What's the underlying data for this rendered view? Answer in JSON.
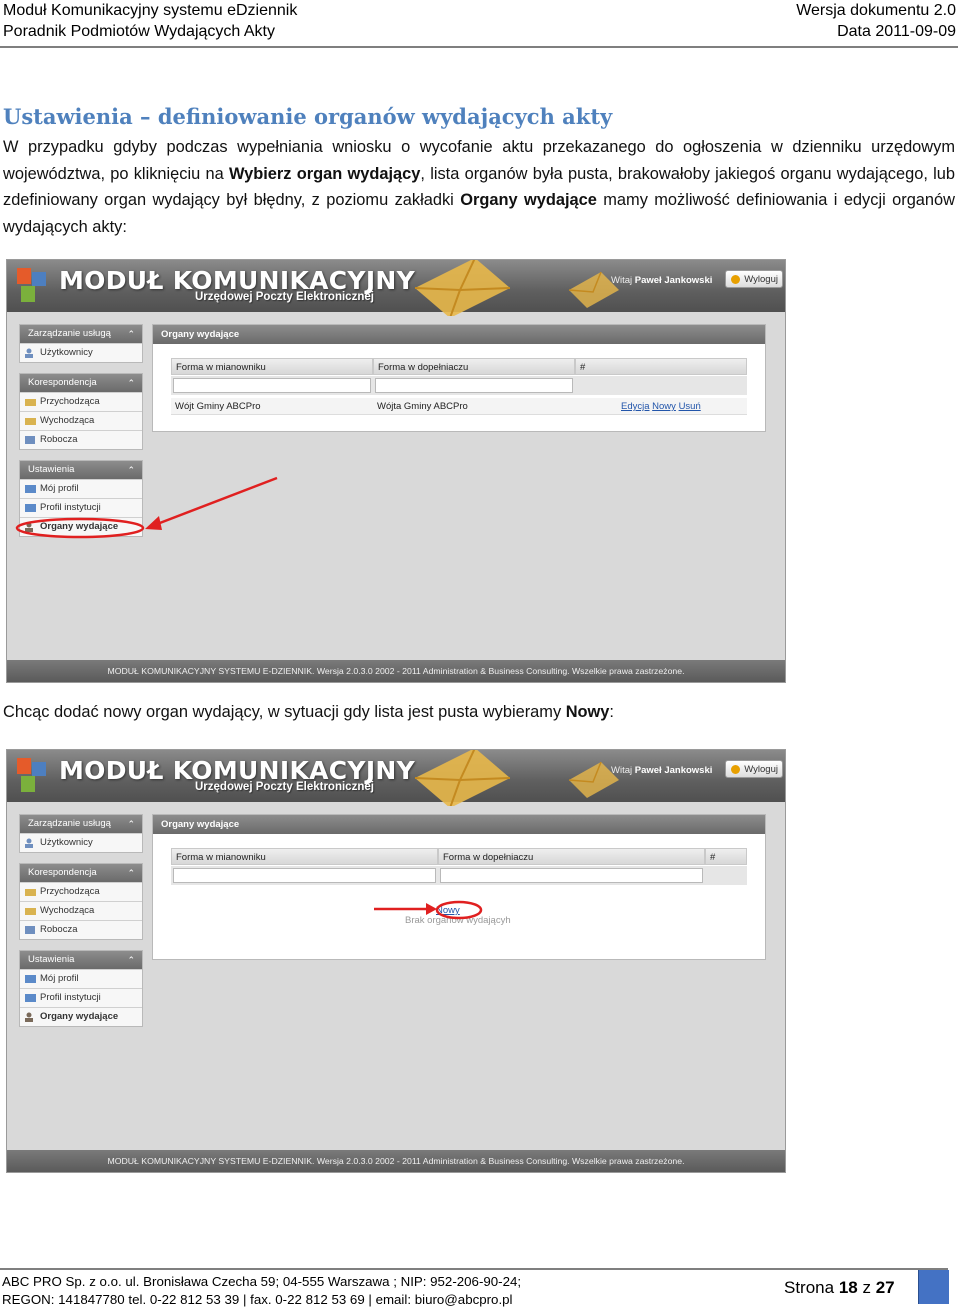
{
  "page_header": {
    "left_line1": "Moduł Komunikacyjny systemu eDziennik",
    "left_line2": "Poradnik Podmiotów Wydających Akty",
    "right_line1": "Wersja dokumentu 2.0",
    "right_line2": "Data 2011-09-09"
  },
  "section": {
    "heading": "Ustawienia – definiowanie organów wydających akty",
    "para_part1": "W przypadku gdyby podczas wypełniania wniosku o wycofanie aktu przekazanego do ogłoszenia w dzienniku urzędowym województwa, po kliknięciu na ",
    "para_bold1": "Wybierz organ wydający",
    "para_part2": ", lista organów była pusta, brakowałoby jakiegoś organu wydającego, lub zdefiniowany organ wydający był błędny, z poziomu zakładki ",
    "para_bold2": "Organy wydające",
    "para_part3": " mamy możliwość definiowania i edycji organów wydających akty:",
    "para2_text": "Chcąc dodać nowy organ wydający, w sytuacji gdy lista jest pusta wybieramy ",
    "para2_bold": "Nowy",
    "para2_end": ":"
  },
  "app": {
    "brand": "MODUŁ KOMUNIKACYJNY",
    "brand_sub": "Urzędowej Poczty Elektronicznej",
    "welcome_prefix": "Witaj",
    "user_name": "Paweł Jankowski",
    "logout_label": "Wyloguj",
    "sidebar": {
      "group1_title": "Zarządzanie usługą",
      "group1_items": [
        "Użytkownicy"
      ],
      "group2_title": "Korespondencja",
      "group2_items": [
        "Przychodząca",
        "Wychodząca",
        "Robocza"
      ],
      "group3_title": "Ustawienia",
      "group3_items": [
        "Mój profil",
        "Profil instytucji",
        "Organy wydające"
      ]
    },
    "content_title": "Organy wydające",
    "columns": [
      "Forma w mianowniku",
      "Forma w dopełniaczu",
      "#"
    ],
    "row": {
      "nominative": "Wójt Gminy ABCPro",
      "genitive": "Wójta Gminy ABCPro"
    },
    "actions": {
      "edit": "Edycja",
      "new": "Nowy",
      "delete": "Usuń"
    },
    "empty_message": "Brak organów wydającyh",
    "footer": "MODUŁ KOMUNIKACYJNY SYSTEMU E-DZIENNIK. Wersja 2.0.3.0 2002 - 2011 Administration & Business Consulting. Wszelkie prawa zastrzeżone.",
    "colors": {
      "accent_red": "#e02020",
      "link": "#2255aa",
      "envelope": "#e8b84a"
    }
  },
  "page_footer": {
    "line1": "ABC PRO Sp. z o.o. ul. Bronisława Czecha 59;  04-555 Warszawa ; NIP: 952-206-90-24;",
    "line2": "REGON: 141847780 tel. 0-22 812 53 39 | fax. 0-22 812 53 69 | email: biuro@abcpro.pl",
    "page_prefix": "Strona",
    "page_current": "18",
    "page_sep": "z",
    "page_total": "27"
  }
}
